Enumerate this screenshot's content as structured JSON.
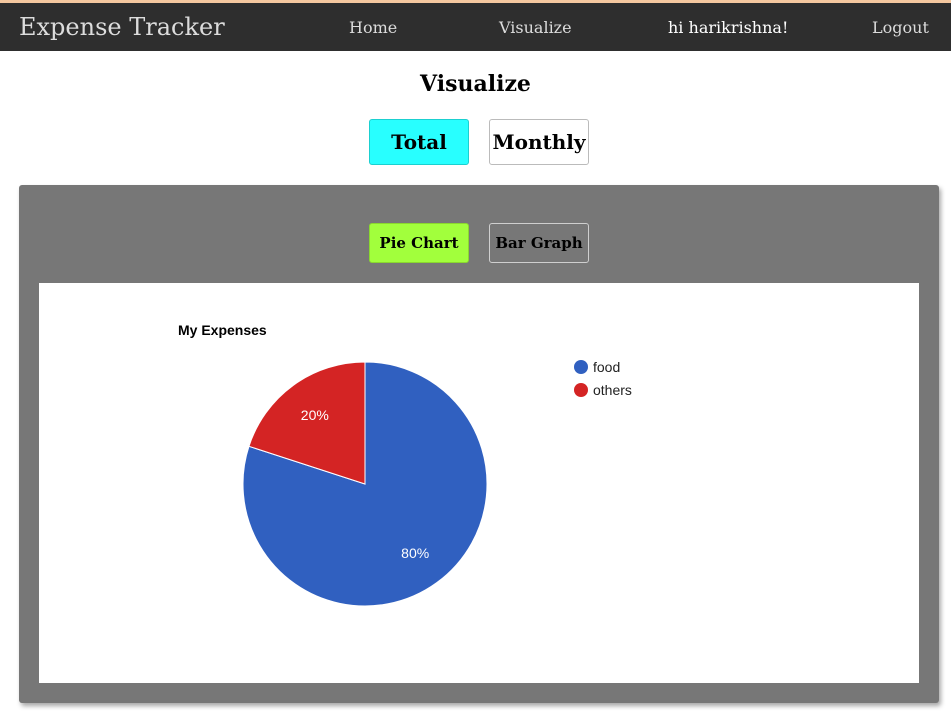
{
  "nav": {
    "brand": "Expense Tracker",
    "home": "Home",
    "visualize": "Visualize",
    "greeting": "hi harikrishna!",
    "logout": "Logout"
  },
  "page": {
    "title": "Visualize"
  },
  "view_toggle": {
    "total": "Total",
    "monthly": "Monthly",
    "active": "Total"
  },
  "chart_toggle": {
    "pie": "Pie Chart",
    "bar": "Bar Graph",
    "active": "Pie Chart"
  },
  "colors": {
    "navbar": "#2e2e2e",
    "total_active": "#28ffff",
    "pie_active": "#a2ff3c",
    "panel": "#777777"
  },
  "chart_data": {
    "type": "pie",
    "title": "My Expenses",
    "labels": [
      "food",
      "others"
    ],
    "values": [
      80,
      20
    ],
    "display_labels": [
      "80%",
      "20%"
    ],
    "colors": [
      "#3060c0",
      "#d42424"
    ],
    "legend": "right"
  }
}
